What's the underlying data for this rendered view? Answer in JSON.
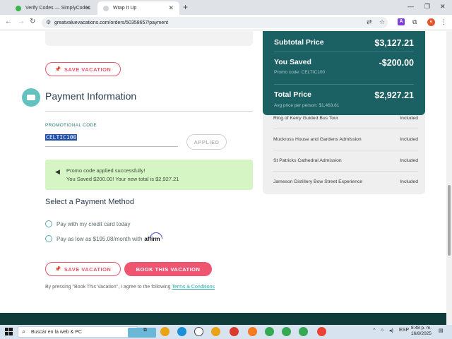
{
  "browser": {
    "tabs": [
      {
        "title": "Verify Codes — SimplyCodes",
        "active": false
      },
      {
        "title": "Wrap It Up",
        "active": true
      }
    ],
    "url": "greatvaluevacations.com/orders/50358657/payment"
  },
  "page": {
    "save_vacation_top": "SAVE VACATION",
    "payment_title": "Payment Information",
    "promo_label": "PROMOTIONAL CODE",
    "promo_value": "CELTIC100",
    "applied_label": "APPLIED",
    "alert_line1": "Promo code applied successfully!",
    "alert_line2": "You Saved $200.00! Your new total is $2,927.21",
    "select_method_title": "Select a Payment Method",
    "option_card": "Pay with my credit card today",
    "option_affirm_prefix": "Pay as low as $195.08/month with",
    "affirm_brand": "affirm",
    "save_vacation_bottom": "SAVE VACATION",
    "book_label": "BOOK THIS VACATION",
    "legal_prefix": "By pressing \"Book This Vacation\", I agree to the following",
    "legal_link": "Terms & Conditions"
  },
  "summary": {
    "subtotal_label": "Subtotal Price",
    "subtotal_value": "$3,127.21",
    "saved_label": "You Saved",
    "saved_value": "-$200.00",
    "promo_note": "Promo code: CELTIC100",
    "total_label": "Total Price",
    "total_value": "$2,927.21",
    "per_person": "Avg price per person: $1,463.61"
  },
  "included": [
    {
      "name": "Ring of Kerry Guided Bus Tour",
      "status": "Included"
    },
    {
      "name": "Muckross House and Gardens Admission",
      "status": "Included"
    },
    {
      "name": "St Patricks Cathedral Admission",
      "status": "Included"
    },
    {
      "name": "Jameson Distillery Bow Street Experience",
      "status": "Included"
    }
  ],
  "taskbar": {
    "search_placeholder": "Buscar en la web & PC",
    "lang": "ESP",
    "time": "8:48 p. m.",
    "date": "16/8/2025"
  },
  "colors": {
    "accent": "#ef5570",
    "teal_dark": "#1b6063",
    "success_bg": "#d5f5c4"
  }
}
